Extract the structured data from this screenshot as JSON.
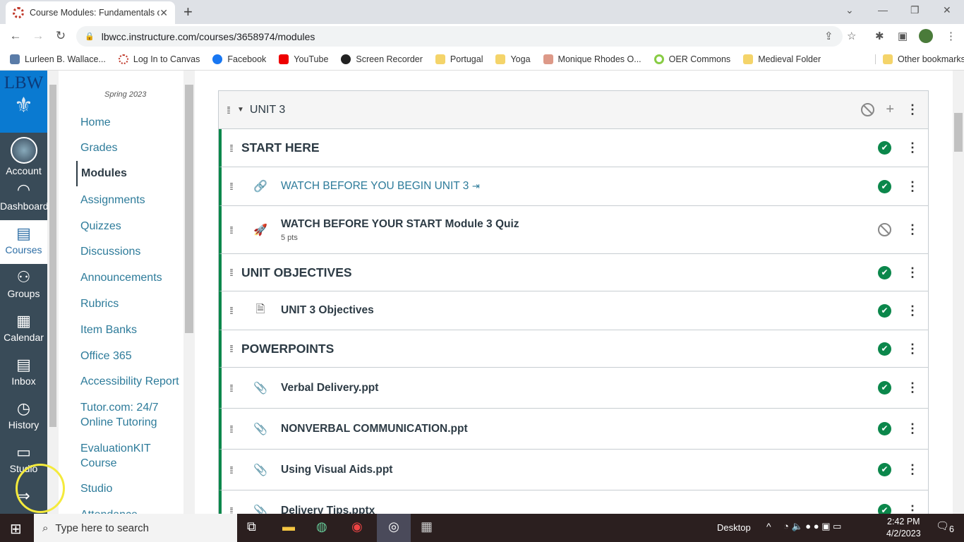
{
  "browser": {
    "tab_title": "Course Modules: Fundamentals o",
    "url": "lbwcc.instructure.com/courses/3658974/modules",
    "bookmarks": [
      "Lurleen B. Wallace...",
      "Log In to Canvas",
      "Facebook",
      "YouTube",
      "Screen Recorder",
      "Portugal",
      "Yoga",
      "Monique Rhodes O...",
      "OER Commons",
      "Medieval Folder"
    ],
    "other_bookmarks": "Other bookmarks"
  },
  "global_nav": {
    "logo": "LBW",
    "items": [
      "Account",
      "Dashboard",
      "Courses",
      "Groups",
      "Calendar",
      "Inbox",
      "History",
      "Studio"
    ],
    "active": "Courses"
  },
  "course_nav": {
    "term": "Spring 2023",
    "items": [
      "Home",
      "Grades",
      "Modules",
      "Assignments",
      "Quizzes",
      "Discussions",
      "Announcements",
      "Rubrics",
      "Item Banks",
      "Office 365",
      "Accessibility Report",
      "Tutor.com: 24/7 Online Tutoring",
      "EvaluationKIT Course",
      "Studio",
      "Attendance"
    ],
    "active": "Modules"
  },
  "module": {
    "title": "UNIT 3",
    "rows": [
      {
        "type": "header",
        "title": "START HERE",
        "status": "complete"
      },
      {
        "type": "link",
        "title": "WATCH BEFORE YOU BEGIN UNIT 3",
        "status": "complete"
      },
      {
        "type": "quiz",
        "title": "WATCH BEFORE YOUR START Module 3 Quiz",
        "points": "5 pts",
        "status": "unpublished"
      },
      {
        "type": "header",
        "title": "UNIT OBJECTIVES",
        "status": "complete"
      },
      {
        "type": "page",
        "title": "UNIT 3 Objectives",
        "status": "complete"
      },
      {
        "type": "header",
        "title": "POWERPOINTS",
        "status": "complete"
      },
      {
        "type": "file",
        "title": "Verbal Delivery.ppt",
        "status": "complete"
      },
      {
        "type": "file",
        "title": "NONVERBAL COMMUNICATION.ppt",
        "status": "complete"
      },
      {
        "type": "file",
        "title": "Using Visual Aids.ppt",
        "status": "complete"
      },
      {
        "type": "file",
        "title": "Delivery Tips.pptx",
        "status": "complete"
      }
    ]
  },
  "taskbar": {
    "search_placeholder": "Type here to search",
    "desktop": "Desktop",
    "time": "2:42 PM",
    "date": "4/2/2023",
    "notifications": "6"
  },
  "colors": {
    "published": "#0b874b",
    "nav": "#394b58",
    "link": "#2d7b9a"
  }
}
